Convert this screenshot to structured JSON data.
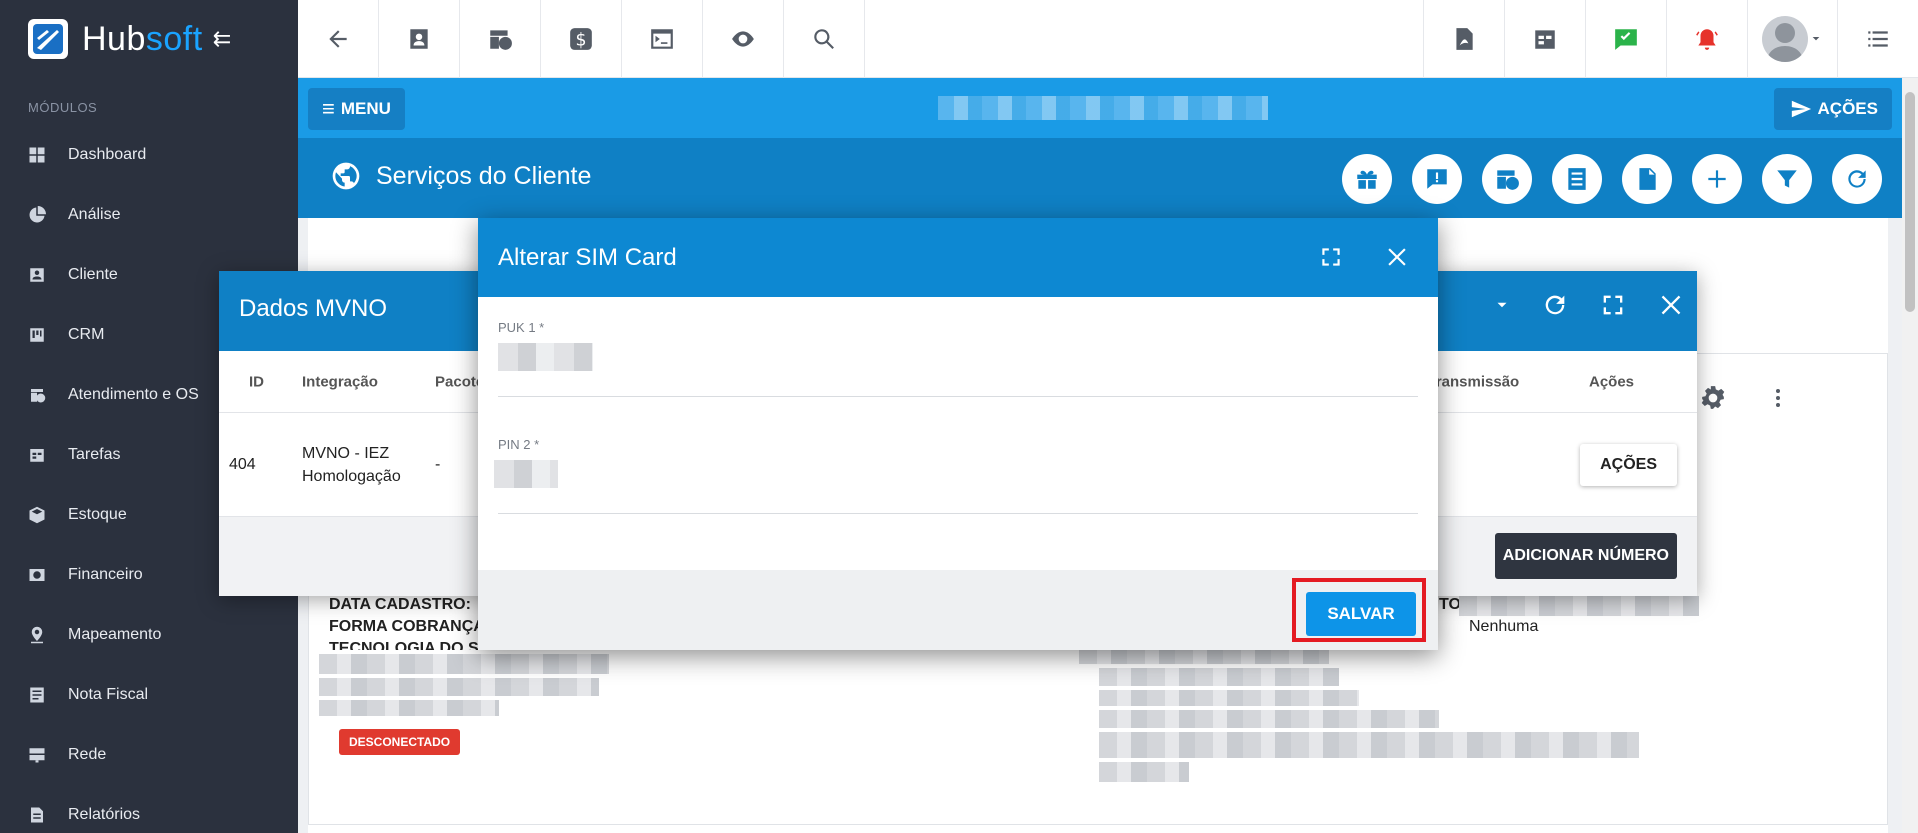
{
  "brand": {
    "name_part1": "Hub",
    "name_part2": "soft",
    "collapse_glyph": "⇇"
  },
  "sidebar": {
    "section_label": "MÓDULOS",
    "items": [
      {
        "label": "Dashboard",
        "icon": "dashboard-icon"
      },
      {
        "label": "Análise",
        "icon": "pie-chart-icon"
      },
      {
        "label": "Cliente",
        "icon": "contact-card-icon"
      },
      {
        "label": "CRM",
        "icon": "kanban-icon"
      },
      {
        "label": "Atendimento e OS",
        "icon": "calendar-clock-icon"
      },
      {
        "label": "Tarefas",
        "icon": "calendar-tasks-icon"
      },
      {
        "label": "Estoque",
        "icon": "box-icon"
      },
      {
        "label": "Financeiro",
        "icon": "money-icon"
      },
      {
        "label": "Mapeamento",
        "icon": "map-pin-icon"
      },
      {
        "label": "Nota Fiscal",
        "icon": "document-list-icon"
      },
      {
        "label": "Rede",
        "icon": "server-icon"
      },
      {
        "label": "Relatórios",
        "icon": "report-icon"
      }
    ]
  },
  "header": {
    "menu_label": "MENU",
    "actions_label": "AÇÕES"
  },
  "services": {
    "title": "Serviços do Cliente"
  },
  "background_card": {
    "data_cadastro": "DATA CADASTRO:",
    "forma_cobranca": "FORMA COBRANÇA",
    "tecnologia": "TECNOLOGIA DO S",
    "status_badge": "DESCONECTADO",
    "right_label": "TO:",
    "right_value": "Nenhuma"
  },
  "mvno_dialog": {
    "title": "Dados MVNO",
    "columns": [
      "ID",
      "Integração",
      "Pacote",
      "s Transmissão",
      "Ações"
    ],
    "row": {
      "id": "404",
      "integracao_line1": "MVNO - IEZ",
      "integracao_line2": "Homologação",
      "pacote": "-",
      "acoes_button": "AÇÕES"
    },
    "add_button": "ADICIONAR NÚMERO"
  },
  "sim_dialog": {
    "title": "Alterar SIM Card",
    "puk_label": "PUK 1 *",
    "pin_label": "PIN 2 *",
    "save_button": "SALVAR"
  }
}
